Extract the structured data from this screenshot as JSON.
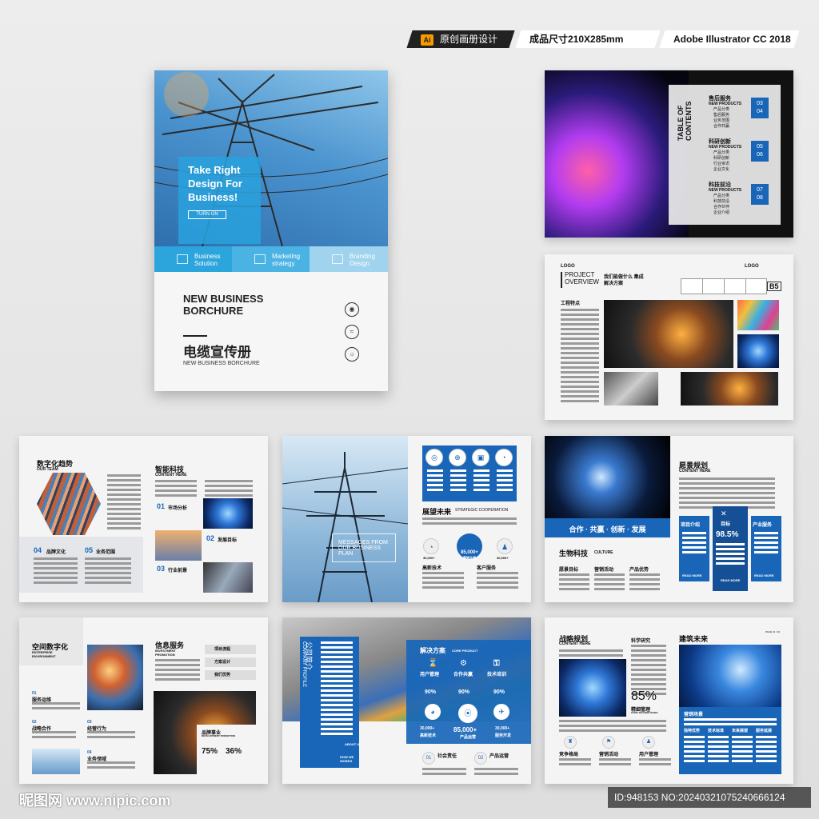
{
  "header_tags": {
    "ai_label": "Ai",
    "design": "原创画册设计",
    "size": "成品尺寸210X285mm",
    "software": "Adobe Illustrator CC 2018"
  },
  "cover": {
    "headline": "Take Right Design For Business!",
    "button": "TURN ON",
    "bar_items": [
      "Business Solution",
      "Marketing strategy",
      "Branding Design"
    ],
    "title": "NEW BUSINESS BORCHURE",
    "title_cn": "电缆宣传册",
    "subtitle": "NEW BUSINESS BORCHURE"
  },
  "toc": {
    "heading": "TABLE OF CONTENTS",
    "sections": [
      {
        "title": "售后服务",
        "sub": "NEW PRODUCTS",
        "items": [
          "产品分类",
          "售后服务",
          "业务范围",
          "合作共赢"
        ],
        "nums": [
          "03",
          "04"
        ]
      },
      {
        "title": "科研创新",
        "sub": "NEW PRODUCTS",
        "items": [
          "产品分类",
          "科研创新",
          "行业资讯",
          "企业文化"
        ],
        "nums": [
          "05",
          "06"
        ]
      },
      {
        "title": "科技前沿",
        "sub": "NEW PRODUCTS",
        "items": [
          "产品分类",
          "科技前沿",
          "合作伙伴",
          "企业介绍"
        ],
        "nums": [
          "07",
          "08"
        ]
      }
    ]
  },
  "spread2": {
    "logo_left": "LOGO",
    "logo_right": "LOGO",
    "overview": "PROJECT OVERVIEW",
    "cn_title": "我们能做什么 集成解决方案",
    "cn_sub": "项目名称",
    "section": "工程特点",
    "badge": "B5"
  },
  "spread3": {
    "left_title": "数字化趋势",
    "left_sub": "OUR TEAM",
    "n04": "04",
    "label04": "品牌文化",
    "n05": "05",
    "label05": "业务范围",
    "right_title": "智能科技",
    "right_sub": "CONTENT HERE",
    "n01": "01",
    "label01": "市场分析",
    "n02": "02",
    "label02": "发展目标",
    "n03": "03",
    "label03": "行业前景"
  },
  "spread4": {
    "overlay": "MESSAGES FROM OUR BUSINESS PLAN",
    "title": "展望未来",
    "title_en": "STRATEGIC COOPERATION",
    "stat_center": "85,000+",
    "stat_center_sub": "营销业绩",
    "stat_left": "30,000+",
    "stat_right": "30,000+",
    "label_left": "高新技术",
    "label_right": "客户服务"
  },
  "spread5": {
    "banner": "合作 · 共赢 · 创新 · 发展",
    "bio_title": "生物科技",
    "bio_en": "CULTURE",
    "cols": [
      "愿景目标",
      "营销活动",
      "产品优势"
    ],
    "right_title": "愿景规划",
    "right_sub": "CONTENT HERE",
    "card_labels": [
      "项目介绍",
      "目标",
      "产业服务"
    ],
    "percent": "98.5%",
    "read_more": "READ MORE"
  },
  "spread6": {
    "title": "空间数字化",
    "title_en": "ENTERPRISE ENVIRONMENT",
    "items": [
      {
        "n": "01",
        "label": "服务运维"
      },
      {
        "n": "02",
        "label": "战略合作"
      },
      {
        "n": "03",
        "label": "经营行为"
      },
      {
        "n": "04",
        "label": "业务领域"
      }
    ],
    "right_title": "信息服务",
    "right_en": "INVESTMENT PROMOTION",
    "list": [
      "项目流程",
      "方案设计",
      "我们优势"
    ],
    "brand": "品牌事业",
    "brand_en": "DEVELOPMENT PROMOTION",
    "p1": "75%",
    "p2": "36%"
  },
  "spread7": {
    "side_cn": "公司简介",
    "side_en": "COMPANY PROFILE",
    "about": "ABOUT US",
    "how": "HOW WE WORKS",
    "title": "解决方案",
    "title_en": "CORE PRODUCT",
    "icons": [
      "用户管理",
      "合作共赢",
      "技术培训"
    ],
    "pcts": [
      "90%",
      "90%",
      "90%"
    ],
    "stat_left": "30,000+",
    "stat_center": "85,000+",
    "stat_right": "30,000+",
    "stat_left_label": "高新技术",
    "stat_center_label": "产品运营",
    "stat_right_label": "服务开发",
    "b01": "01",
    "b01_label": "社会责任",
    "b02": "02",
    "b02_label": "产品运营"
  },
  "spread8": {
    "title": "战略规划",
    "title_en": "CONTENT HERE",
    "research": "科学研究",
    "percent": "85%",
    "percent_label": "精细管理",
    "percent_en": "CORE TECHNOLOGIES",
    "bottom": [
      "竞争格局",
      "营销活动",
      "用户管理"
    ],
    "right_title": "建筑未来",
    "right_page": "PAGE 01 / 02",
    "panel_title": "营销场景",
    "panel_cols": [
      "独特优势",
      "技术标准",
      "未来展望",
      "服务延展"
    ]
  },
  "watermark": "昵图网 www.nipic.com",
  "id_text": "ID:948153 NO:20240321075240666124"
}
